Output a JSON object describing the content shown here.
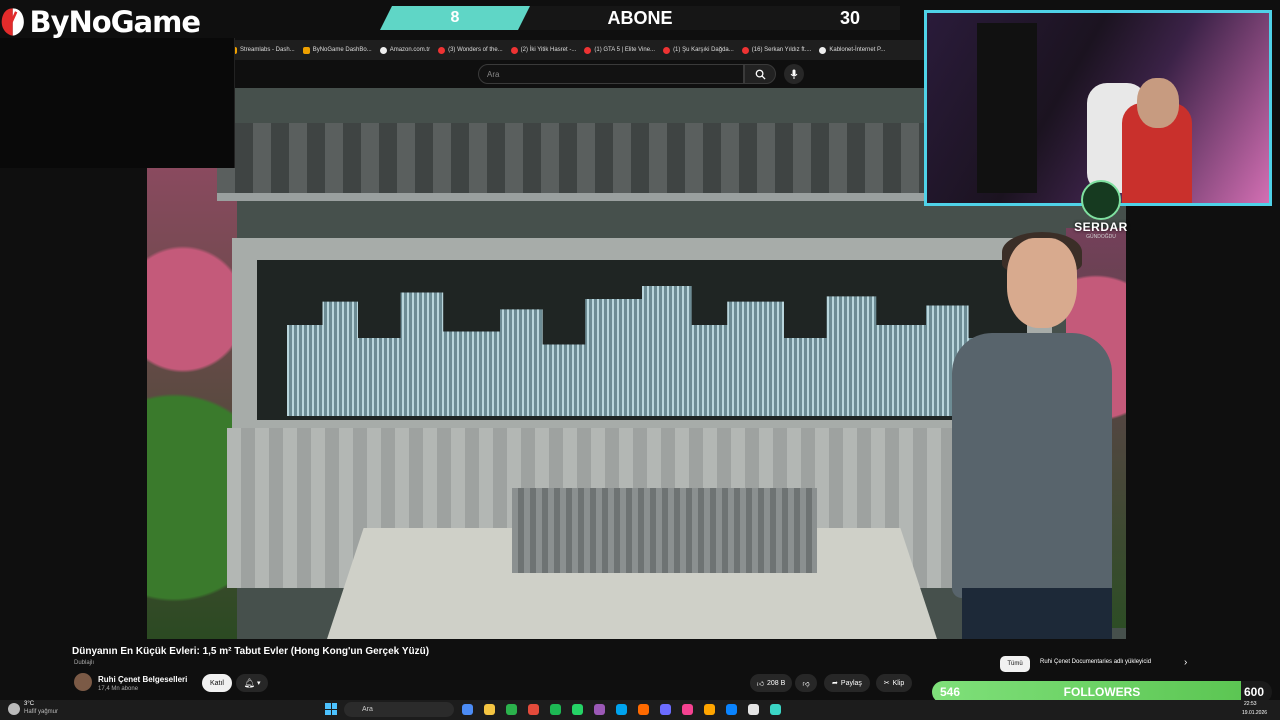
{
  "overlay": {
    "logo_text": "ByNoGame",
    "abone": {
      "current": "8",
      "label": "ABONE",
      "goal": "30"
    },
    "followers": {
      "current": "546",
      "label": "FOLLOWERS",
      "goal": "600",
      "progress_fraction": 0.91
    },
    "streamer_badge": {
      "name": "SERDAR",
      "sub": "GÜNDOĞDU"
    },
    "colors": {
      "accent_teal": "#5fd6c6",
      "webcam_border": "#4fd2e8",
      "followers_green": "#6fd66a"
    }
  },
  "browser": {
    "tab_title": "Dünyanın En Küçük Evleri: 1",
    "bookmarks": [
      {
        "label": "Streamlabs - Dash...",
        "icon": "streamlabs-icon"
      },
      {
        "label": "ByNoGame DashBo...",
        "icon": "bynogame-icon"
      },
      {
        "label": "Amazon.com.tr",
        "icon": "amazon-icon"
      },
      {
        "label": "(3) Wonders of the...",
        "icon": "youtube-icon"
      },
      {
        "label": "(2) İki Yitik Hasret -...",
        "icon": "youtube-icon"
      },
      {
        "label": "(1) GTA 5 | Elite Vine...",
        "icon": "youtube-icon"
      },
      {
        "label": "(1) Şu Karşıki Dağda...",
        "icon": "youtube-icon"
      },
      {
        "label": "(16) Serkan Yıldız ft....",
        "icon": "youtube-icon"
      },
      {
        "label": "Kablonet-İnternet P...",
        "icon": "kablonet-icon"
      }
    ],
    "search": {
      "placeholder": "Ara"
    }
  },
  "video": {
    "title": "Dünyanın En Küçük Evleri: 1,5 m² Tabut Evler (Hong Kong'un Gerçek Yüzü)",
    "dubbed_label": "Dublajlı",
    "channel_name": "Ruhi Çenet Belgeselleri",
    "channel_subs": "17,4 Mn abone",
    "join_label": "Katıl",
    "like_count": "208 B",
    "share_label": "Paylaş",
    "clip_label": "Klip"
  },
  "recommend_tabs": {
    "all": "Tümü",
    "channel": "Ruhi Çenet Documentaries adlı yükleyicid"
  },
  "taskbar": {
    "weather_temp": "3°C",
    "weather_desc": "Hafif yağmur",
    "search_placeholder": "Ara",
    "time": "22:53",
    "date": "19.01.2026"
  }
}
